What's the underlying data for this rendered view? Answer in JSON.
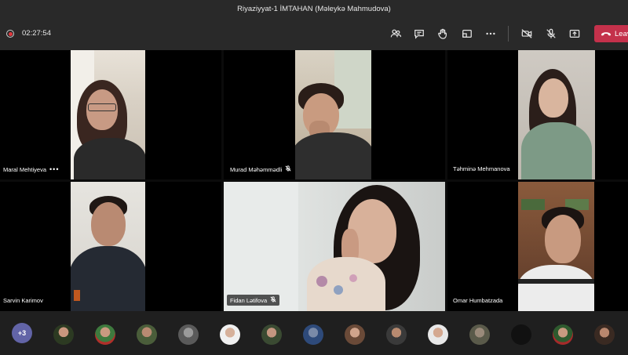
{
  "window": {
    "title": "Riyaziyyat-1 İMTAHAN (Məleykə Mahmudova)"
  },
  "toolbar": {
    "timer": "02:27:54",
    "leave_label": "Leave",
    "icons": [
      "participants-icon",
      "chat-icon",
      "raise-hand-icon",
      "breakout-icon",
      "more-actions-icon",
      "camera-off-icon",
      "mic-off-icon",
      "share-tray-icon"
    ],
    "leave_color": "#c4314b"
  },
  "participants": [
    {
      "name": "Maral Mehtiyeva",
      "more": "•••"
    },
    {
      "name": "Murad Məhəmmədli"
    },
    {
      "name": "Təhminə Mehmanova"
    },
    {
      "name": "Sarvin Karimov"
    },
    {
      "name": "Fidan Lətifova"
    },
    {
      "name": "Omar Humbatzada"
    }
  ],
  "roster": {
    "more_count": "+3",
    "avatar_count": 15
  },
  "colors": {
    "background": "#1f1f1f",
    "accent": "#6264a7"
  }
}
